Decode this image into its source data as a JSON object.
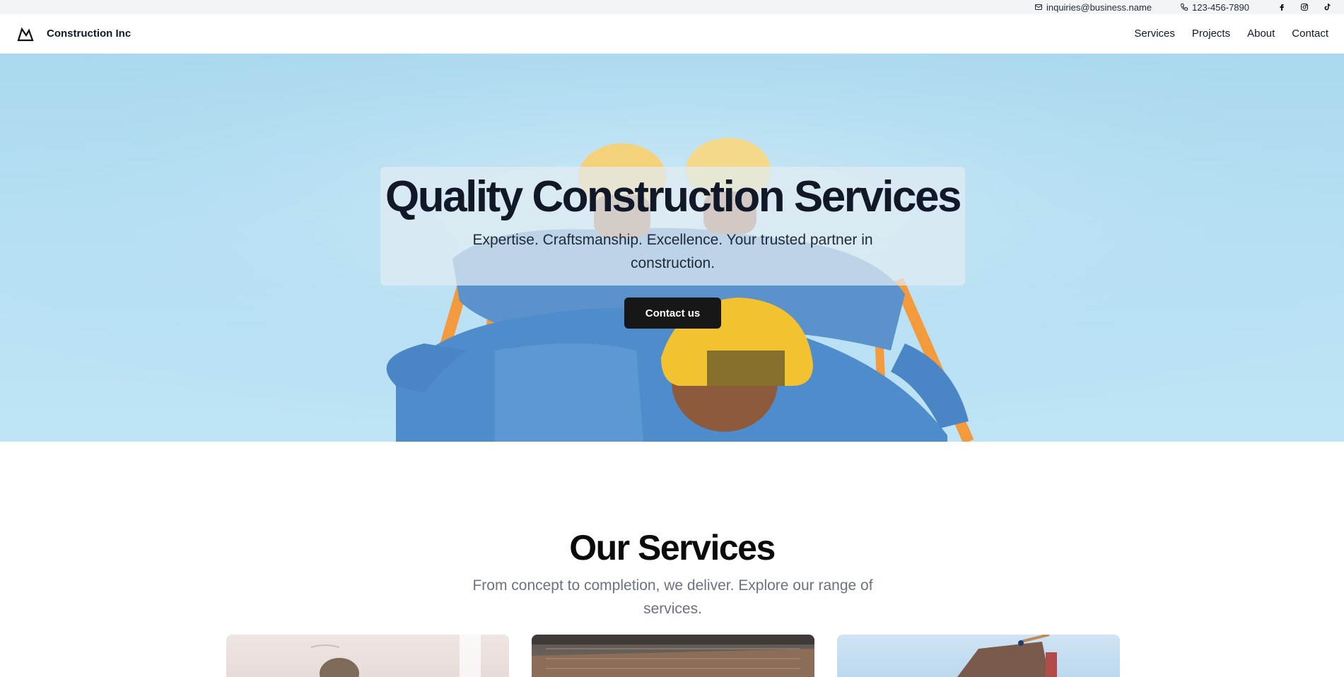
{
  "topbar": {
    "email": "inquiries@business.name",
    "phone": "123-456-7890",
    "icons": [
      "mail-icon",
      "phone-icon",
      "facebook-icon",
      "instagram-icon",
      "tiktok-icon"
    ]
  },
  "nav": {
    "brand_name": "Construction Inc",
    "links": [
      "Services",
      "Projects",
      "About",
      "Contact"
    ]
  },
  "hero": {
    "title": "Quality Construction Services",
    "subtitle": "Expertise. Craftsmanship. Excellence. Your trusted partner in construction.",
    "cta_label": "Contact us"
  },
  "services": {
    "title": "Our Services",
    "subtitle": "From concept to completion, we deliver. Explore our range of services."
  },
  "colors": {
    "accent": "#171717",
    "sky": "#b7e0f3",
    "muted_text": "#6b7280",
    "helmet": "#f2c230",
    "shirt": "#4f8ccb"
  }
}
